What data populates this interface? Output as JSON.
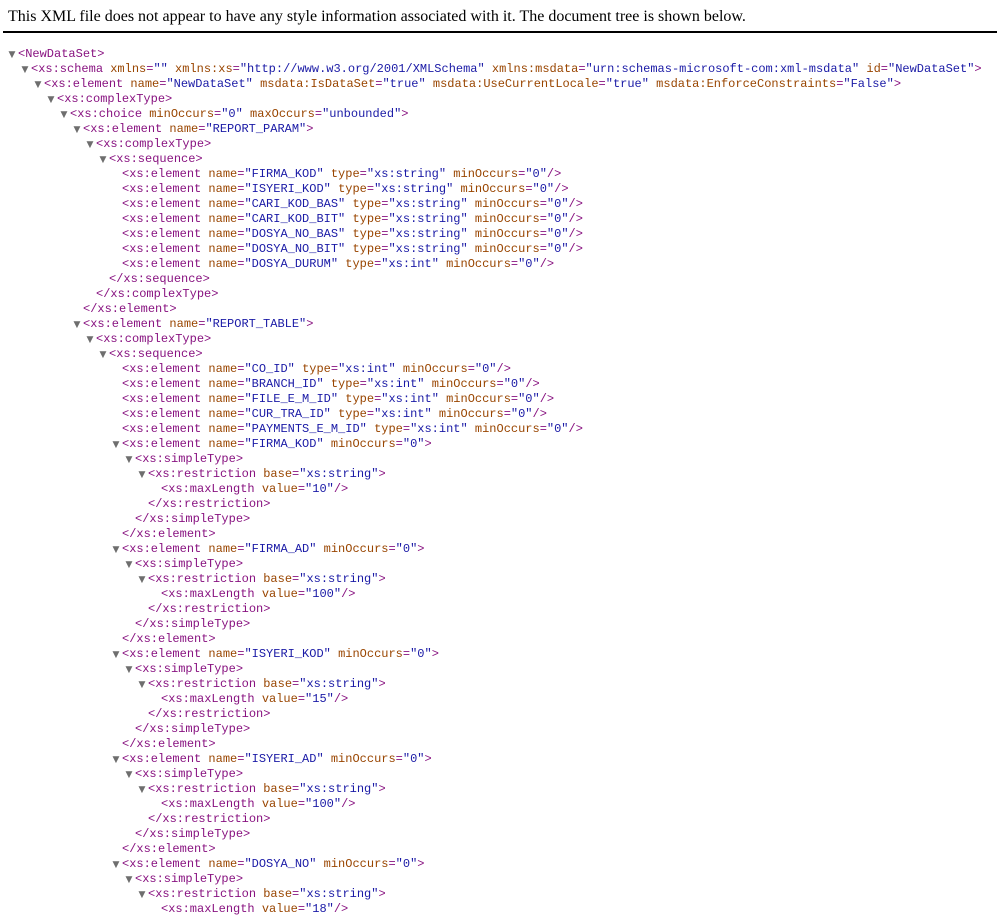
{
  "page": {
    "info_message": "This XML file does not appear to have any style information associated with it. The document tree is shown below."
  },
  "colors": {
    "tag": "#881280",
    "attribute_name": "#994500",
    "attribute_value": "#1a1aa6",
    "toggle_arrow": "#6e6e6e"
  },
  "icons": {
    "toggle": "triangle-down-icon",
    "toggle_glyph": "▼"
  },
  "lines": [
    {
      "depth": 0,
      "kind": "open",
      "toggle": true,
      "tag": "NewDataSet",
      "attrs": []
    },
    {
      "depth": 1,
      "kind": "open",
      "toggle": true,
      "tag": "xs:schema",
      "attrs": [
        [
          "xmlns",
          ""
        ],
        [
          "xmlns:xs",
          "http://www.w3.org/2001/XMLSchema"
        ],
        [
          "xmlns:msdata",
          "urn:schemas-microsoft-com:xml-msdata"
        ],
        [
          "id",
          "NewDataSet"
        ]
      ]
    },
    {
      "depth": 2,
      "kind": "open",
      "toggle": true,
      "tag": "xs:element",
      "attrs": [
        [
          "name",
          "NewDataSet"
        ],
        [
          "msdata:IsDataSet",
          "true"
        ],
        [
          "msdata:UseCurrentLocale",
          "true"
        ],
        [
          "msdata:EnforceConstraints",
          "False"
        ]
      ]
    },
    {
      "depth": 3,
      "kind": "open",
      "toggle": true,
      "tag": "xs:complexType",
      "attrs": []
    },
    {
      "depth": 4,
      "kind": "open",
      "toggle": true,
      "tag": "xs:choice",
      "attrs": [
        [
          "minOccurs",
          "0"
        ],
        [
          "maxOccurs",
          "unbounded"
        ]
      ]
    },
    {
      "depth": 5,
      "kind": "open",
      "toggle": true,
      "tag": "xs:element",
      "attrs": [
        [
          "name",
          "REPORT_PARAM"
        ]
      ]
    },
    {
      "depth": 6,
      "kind": "open",
      "toggle": true,
      "tag": "xs:complexType",
      "attrs": []
    },
    {
      "depth": 7,
      "kind": "open",
      "toggle": true,
      "tag": "xs:sequence",
      "attrs": []
    },
    {
      "depth": 8,
      "kind": "self",
      "toggle": false,
      "tag": "xs:element",
      "attrs": [
        [
          "name",
          "FIRMA_KOD"
        ],
        [
          "type",
          "xs:string"
        ],
        [
          "minOccurs",
          "0"
        ]
      ]
    },
    {
      "depth": 8,
      "kind": "self",
      "toggle": false,
      "tag": "xs:element",
      "attrs": [
        [
          "name",
          "ISYERI_KOD"
        ],
        [
          "type",
          "xs:string"
        ],
        [
          "minOccurs",
          "0"
        ]
      ]
    },
    {
      "depth": 8,
      "kind": "self",
      "toggle": false,
      "tag": "xs:element",
      "attrs": [
        [
          "name",
          "CARI_KOD_BAS"
        ],
        [
          "type",
          "xs:string"
        ],
        [
          "minOccurs",
          "0"
        ]
      ]
    },
    {
      "depth": 8,
      "kind": "self",
      "toggle": false,
      "tag": "xs:element",
      "attrs": [
        [
          "name",
          "CARI_KOD_BIT"
        ],
        [
          "type",
          "xs:string"
        ],
        [
          "minOccurs",
          "0"
        ]
      ]
    },
    {
      "depth": 8,
      "kind": "self",
      "toggle": false,
      "tag": "xs:element",
      "attrs": [
        [
          "name",
          "DOSYA_NO_BAS"
        ],
        [
          "type",
          "xs:string"
        ],
        [
          "minOccurs",
          "0"
        ]
      ]
    },
    {
      "depth": 8,
      "kind": "self",
      "toggle": false,
      "tag": "xs:element",
      "attrs": [
        [
          "name",
          "DOSYA_NO_BIT"
        ],
        [
          "type",
          "xs:string"
        ],
        [
          "minOccurs",
          "0"
        ]
      ]
    },
    {
      "depth": 8,
      "kind": "self",
      "toggle": false,
      "tag": "xs:element",
      "attrs": [
        [
          "name",
          "DOSYA_DURUM"
        ],
        [
          "type",
          "xs:int"
        ],
        [
          "minOccurs",
          "0"
        ]
      ]
    },
    {
      "depth": 7,
      "kind": "close",
      "toggle": false,
      "tag": "xs:sequence",
      "attrs": []
    },
    {
      "depth": 6,
      "kind": "close",
      "toggle": false,
      "tag": "xs:complexType",
      "attrs": []
    },
    {
      "depth": 5,
      "kind": "close",
      "toggle": false,
      "tag": "xs:element",
      "attrs": []
    },
    {
      "depth": 5,
      "kind": "open",
      "toggle": true,
      "tag": "xs:element",
      "attrs": [
        [
          "name",
          "REPORT_TABLE"
        ]
      ]
    },
    {
      "depth": 6,
      "kind": "open",
      "toggle": true,
      "tag": "xs:complexType",
      "attrs": []
    },
    {
      "depth": 7,
      "kind": "open",
      "toggle": true,
      "tag": "xs:sequence",
      "attrs": []
    },
    {
      "depth": 8,
      "kind": "self",
      "toggle": false,
      "tag": "xs:element",
      "attrs": [
        [
          "name",
          "CO_ID"
        ],
        [
          "type",
          "xs:int"
        ],
        [
          "minOccurs",
          "0"
        ]
      ]
    },
    {
      "depth": 8,
      "kind": "self",
      "toggle": false,
      "tag": "xs:element",
      "attrs": [
        [
          "name",
          "BRANCH_ID"
        ],
        [
          "type",
          "xs:int"
        ],
        [
          "minOccurs",
          "0"
        ]
      ]
    },
    {
      "depth": 8,
      "kind": "self",
      "toggle": false,
      "tag": "xs:element",
      "attrs": [
        [
          "name",
          "FILE_E_M_ID"
        ],
        [
          "type",
          "xs:int"
        ],
        [
          "minOccurs",
          "0"
        ]
      ]
    },
    {
      "depth": 8,
      "kind": "self",
      "toggle": false,
      "tag": "xs:element",
      "attrs": [
        [
          "name",
          "CUR_TRA_ID"
        ],
        [
          "type",
          "xs:int"
        ],
        [
          "minOccurs",
          "0"
        ]
      ]
    },
    {
      "depth": 8,
      "kind": "self",
      "toggle": false,
      "tag": "xs:element",
      "attrs": [
        [
          "name",
          "PAYMENTS_E_M_ID"
        ],
        [
          "type",
          "xs:int"
        ],
        [
          "minOccurs",
          "0"
        ]
      ]
    },
    {
      "depth": 8,
      "kind": "open",
      "toggle": true,
      "tag": "xs:element",
      "attrs": [
        [
          "name",
          "FIRMA_KOD"
        ],
        [
          "minOccurs",
          "0"
        ]
      ]
    },
    {
      "depth": 9,
      "kind": "open",
      "toggle": true,
      "tag": "xs:simpleType",
      "attrs": []
    },
    {
      "depth": 10,
      "kind": "open",
      "toggle": true,
      "tag": "xs:restriction",
      "attrs": [
        [
          "base",
          "xs:string"
        ]
      ]
    },
    {
      "depth": 11,
      "kind": "self",
      "toggle": false,
      "tag": "xs:maxLength",
      "attrs": [
        [
          "value",
          "10"
        ]
      ]
    },
    {
      "depth": 10,
      "kind": "close",
      "toggle": false,
      "tag": "xs:restriction",
      "attrs": []
    },
    {
      "depth": 9,
      "kind": "close",
      "toggle": false,
      "tag": "xs:simpleType",
      "attrs": []
    },
    {
      "depth": 8,
      "kind": "close",
      "toggle": false,
      "tag": "xs:element",
      "attrs": []
    },
    {
      "depth": 8,
      "kind": "open",
      "toggle": true,
      "tag": "xs:element",
      "attrs": [
        [
          "name",
          "FIRMA_AD"
        ],
        [
          "minOccurs",
          "0"
        ]
      ]
    },
    {
      "depth": 9,
      "kind": "open",
      "toggle": true,
      "tag": "xs:simpleType",
      "attrs": []
    },
    {
      "depth": 10,
      "kind": "open",
      "toggle": true,
      "tag": "xs:restriction",
      "attrs": [
        [
          "base",
          "xs:string"
        ]
      ]
    },
    {
      "depth": 11,
      "kind": "self",
      "toggle": false,
      "tag": "xs:maxLength",
      "attrs": [
        [
          "value",
          "100"
        ]
      ]
    },
    {
      "depth": 10,
      "kind": "close",
      "toggle": false,
      "tag": "xs:restriction",
      "attrs": []
    },
    {
      "depth": 9,
      "kind": "close",
      "toggle": false,
      "tag": "xs:simpleType",
      "attrs": []
    },
    {
      "depth": 8,
      "kind": "close",
      "toggle": false,
      "tag": "xs:element",
      "attrs": []
    },
    {
      "depth": 8,
      "kind": "open",
      "toggle": true,
      "tag": "xs:element",
      "attrs": [
        [
          "name",
          "ISYERI_KOD"
        ],
        [
          "minOccurs",
          "0"
        ]
      ]
    },
    {
      "depth": 9,
      "kind": "open",
      "toggle": true,
      "tag": "xs:simpleType",
      "attrs": []
    },
    {
      "depth": 10,
      "kind": "open",
      "toggle": true,
      "tag": "xs:restriction",
      "attrs": [
        [
          "base",
          "xs:string"
        ]
      ]
    },
    {
      "depth": 11,
      "kind": "self",
      "toggle": false,
      "tag": "xs:maxLength",
      "attrs": [
        [
          "value",
          "15"
        ]
      ]
    },
    {
      "depth": 10,
      "kind": "close",
      "toggle": false,
      "tag": "xs:restriction",
      "attrs": []
    },
    {
      "depth": 9,
      "kind": "close",
      "toggle": false,
      "tag": "xs:simpleType",
      "attrs": []
    },
    {
      "depth": 8,
      "kind": "close",
      "toggle": false,
      "tag": "xs:element",
      "attrs": []
    },
    {
      "depth": 8,
      "kind": "open",
      "toggle": true,
      "tag": "xs:element",
      "attrs": [
        [
          "name",
          "ISYERI_AD"
        ],
        [
          "minOccurs",
          "0"
        ]
      ]
    },
    {
      "depth": 9,
      "kind": "open",
      "toggle": true,
      "tag": "xs:simpleType",
      "attrs": []
    },
    {
      "depth": 10,
      "kind": "open",
      "toggle": true,
      "tag": "xs:restriction",
      "attrs": [
        [
          "base",
          "xs:string"
        ]
      ]
    },
    {
      "depth": 11,
      "kind": "self",
      "toggle": false,
      "tag": "xs:maxLength",
      "attrs": [
        [
          "value",
          "100"
        ]
      ]
    },
    {
      "depth": 10,
      "kind": "close",
      "toggle": false,
      "tag": "xs:restriction",
      "attrs": []
    },
    {
      "depth": 9,
      "kind": "close",
      "toggle": false,
      "tag": "xs:simpleType",
      "attrs": []
    },
    {
      "depth": 8,
      "kind": "close",
      "toggle": false,
      "tag": "xs:element",
      "attrs": []
    },
    {
      "depth": 8,
      "kind": "open",
      "toggle": true,
      "tag": "xs:element",
      "attrs": [
        [
          "name",
          "DOSYA_NO"
        ],
        [
          "minOccurs",
          "0"
        ]
      ]
    },
    {
      "depth": 9,
      "kind": "open",
      "toggle": true,
      "tag": "xs:simpleType",
      "attrs": []
    },
    {
      "depth": 10,
      "kind": "open",
      "toggle": true,
      "tag": "xs:restriction",
      "attrs": [
        [
          "base",
          "xs:string"
        ]
      ]
    },
    {
      "depth": 11,
      "kind": "self",
      "toggle": false,
      "tag": "xs:maxLength",
      "attrs": [
        [
          "value",
          "18"
        ]
      ]
    }
  ]
}
